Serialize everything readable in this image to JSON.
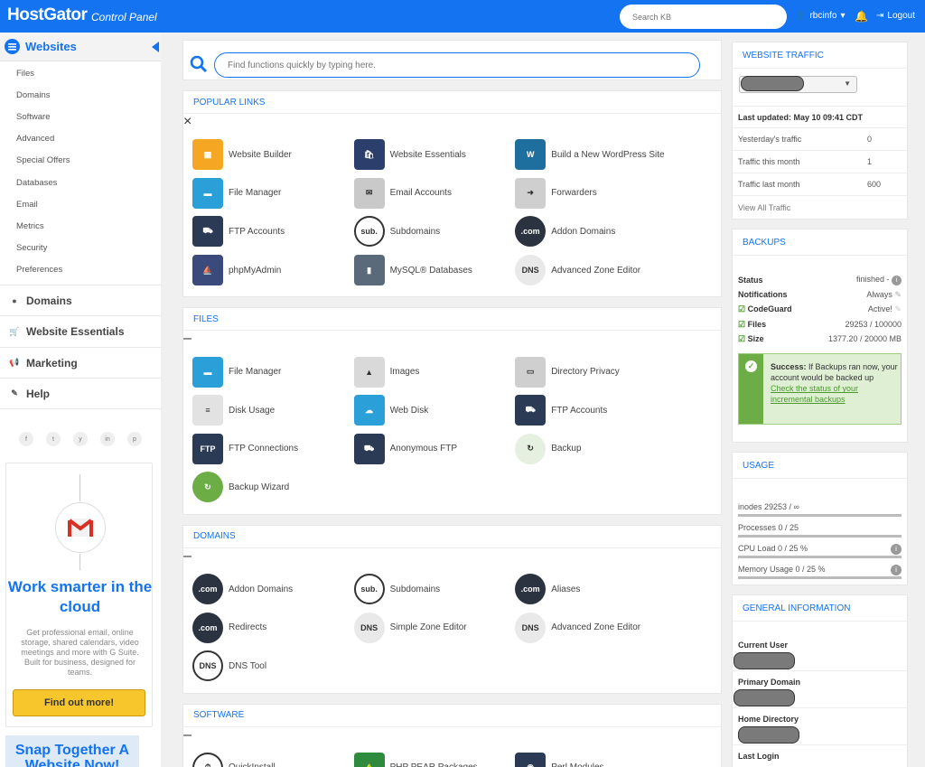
{
  "header": {
    "logo": "HostGator",
    "logo_sub": "Control Panel",
    "search_placeholder": "Search KB",
    "user": "rbcinfo",
    "logout": "Logout"
  },
  "sidebar": {
    "section": "Websites",
    "sub_items": [
      "Files",
      "Domains",
      "Software",
      "Advanced",
      "Special Offers",
      "Databases",
      "Email",
      "Metrics",
      "Security",
      "Preferences"
    ],
    "main_items": [
      {
        "label": "Domains",
        "icon": "globe-icon"
      },
      {
        "label": "Website Essentials",
        "icon": "cart-icon"
      },
      {
        "label": "Marketing",
        "icon": "megaphone-icon"
      },
      {
        "label": "Help",
        "icon": "tag-icon"
      }
    ],
    "social": [
      "f",
      "t",
      "y",
      "in",
      "p"
    ],
    "ad": {
      "title": "Work smarter in the cloud",
      "text": "Get professional email, online storage, shared calendars, video meetings and more with G Suite. Built for business, designed for teams.",
      "button": "Find out more!"
    },
    "ad2_title": "Snap Together A Website Now!"
  },
  "center": {
    "find_placeholder": "Find functions quickly by typing here.",
    "panels": [
      {
        "title": "POPULAR LINKS",
        "ctrl": "×",
        "items": [
          {
            "label": "Website Builder",
            "color": "#f5a623",
            "glyph": "▦"
          },
          {
            "label": "Website Essentials",
            "color": "#2c3e6b",
            "glyph": "🛍"
          },
          {
            "label": "Build a New WordPress Site",
            "color": "#1f6f9e",
            "glyph": "W"
          },
          {
            "label": "File Manager",
            "color": "#2a9fd8",
            "glyph": "▬"
          },
          {
            "label": "Email Accounts",
            "color": "#c9c9c9",
            "glyph": "✉"
          },
          {
            "label": "Forwarders",
            "color": "#cfcfcf",
            "glyph": "➜"
          },
          {
            "label": "FTP Accounts",
            "color": "#2b3a55",
            "glyph": "⛟"
          },
          {
            "label": "Subdomains",
            "color": "#ffffff",
            "glyph": "sub."
          },
          {
            "label": "Addon Domains",
            "color": "#2b3340",
            "glyph": ".com"
          },
          {
            "label": "phpMyAdmin",
            "color": "#3a4a7a",
            "glyph": "⛵"
          },
          {
            "label": "MySQL® Databases",
            "color": "#5a6a7a",
            "glyph": "▮"
          },
          {
            "label": "Advanced Zone Editor",
            "color": "#e9e9e9",
            "glyph": "DNS"
          }
        ]
      },
      {
        "title": "FILES",
        "ctrl": "–",
        "items": [
          {
            "label": "File Manager",
            "color": "#2a9fd8",
            "glyph": "▬"
          },
          {
            "label": "Images",
            "color": "#d9d9d9",
            "glyph": "▲"
          },
          {
            "label": "Directory Privacy",
            "color": "#cfcfcf",
            "glyph": "▭"
          },
          {
            "label": "Disk Usage",
            "color": "#e2e2e2",
            "glyph": "≡"
          },
          {
            "label": "Web Disk",
            "color": "#2a9fd8",
            "glyph": "☁"
          },
          {
            "label": "FTP Accounts",
            "color": "#2b3a55",
            "glyph": "⛟"
          },
          {
            "label": "FTP Connections",
            "color": "#2b3a55",
            "glyph": "FTP"
          },
          {
            "label": "Anonymous FTP",
            "color": "#2b3a55",
            "glyph": "⛟"
          },
          {
            "label": "Backup",
            "color": "#e6f0e0",
            "glyph": "↻"
          },
          {
            "label": "Backup Wizard",
            "color": "#6cad46",
            "glyph": "↻"
          }
        ]
      },
      {
        "title": "DOMAINS",
        "ctrl": "–",
        "items": [
          {
            "label": "Addon Domains",
            "color": "#2b3340",
            "glyph": ".com"
          },
          {
            "label": "Subdomains",
            "color": "#ffffff",
            "glyph": "sub."
          },
          {
            "label": "Aliases",
            "color": "#2b3340",
            "glyph": ".com"
          },
          {
            "label": "Redirects",
            "color": "#2b3340",
            "glyph": ".com"
          },
          {
            "label": "Simple Zone Editor",
            "color": "#e9e9e9",
            "glyph": "DNS"
          },
          {
            "label": "Advanced Zone Editor",
            "color": "#e9e9e9",
            "glyph": "DNS"
          },
          {
            "label": "DNS Tool",
            "color": "#ffffff",
            "glyph": "DNS"
          }
        ]
      },
      {
        "title": "SOFTWARE",
        "ctrl": "–",
        "items": [
          {
            "label": "QuickInstall",
            "color": "#ffffff",
            "glyph": "⏱"
          },
          {
            "label": "PHP PEAR Packages",
            "color": "#2e8b3e",
            "glyph": "🍐"
          },
          {
            "label": "Perl Modules",
            "color": "#2b3a55",
            "glyph": "◉"
          }
        ]
      }
    ]
  },
  "right": {
    "traffic": {
      "title": "WEBSITE TRAFFIC",
      "updated": "Last updated: May 10 09:41 CDT",
      "rows": [
        {
          "label": "Yesterday's traffic",
          "value": "0"
        },
        {
          "label": "Traffic this month",
          "value": "1"
        },
        {
          "label": "Traffic last month",
          "value": "600"
        }
      ],
      "link": "View All Traffic"
    },
    "backups": {
      "title": "BACKUPS",
      "rows": [
        {
          "label": "Status",
          "value": "finished -"
        },
        {
          "label": "Notifications",
          "value": "Always"
        },
        {
          "label": "CodeGuard",
          "value": "Active!"
        },
        {
          "label": "Files",
          "value": "29253 / 100000"
        },
        {
          "label": "Size",
          "value": "1377.20 / 20000 MB"
        }
      ],
      "success_bold": "Success:",
      "success_text": "If Backups ran now, your account would be backed up",
      "success_link": "Check the status of your incremental backups"
    },
    "usage": {
      "title": "USAGE",
      "rows": [
        "inodes 29253 / ∞",
        "Processes 0 / 25",
        "CPU Load 0 / 25 %",
        "Memory Usage 0 / 25 %"
      ]
    },
    "general": {
      "title": "GENERAL INFORMATION",
      "rows": [
        "Current User",
        "Primary Domain",
        "Home Directory",
        "Last Login"
      ]
    }
  }
}
